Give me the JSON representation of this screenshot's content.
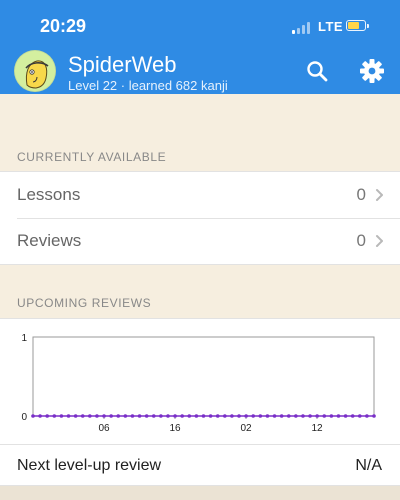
{
  "status_bar": {
    "time": "20:29",
    "network": "LTE",
    "signal_bars_on": 1,
    "battery_color": "#ffd54a"
  },
  "header": {
    "username": "SpiderWeb",
    "subtitle": "Level 22 · learned 682 kanji",
    "background": "#2f8be4",
    "icons": [
      "search-icon",
      "gear-icon"
    ]
  },
  "currently_available": {
    "title": "CURRENTLY AVAILABLE",
    "rows": [
      {
        "label": "Lessons",
        "value": "0"
      },
      {
        "label": "Reviews",
        "value": "0"
      }
    ]
  },
  "upcoming_reviews": {
    "title": "UPCOMING REVIEWS"
  },
  "chart_data": {
    "type": "line",
    "y_ticks": [
      "1",
      "0"
    ],
    "x_ticks": [
      "06",
      "16",
      "02",
      "12"
    ],
    "ylim": [
      0,
      1
    ],
    "values": [
      0,
      0,
      0,
      0,
      0,
      0,
      0,
      0,
      0,
      0,
      0,
      0,
      0,
      0,
      0,
      0,
      0,
      0,
      0,
      0,
      0,
      0,
      0,
      0,
      0,
      0,
      0,
      0,
      0,
      0,
      0,
      0,
      0,
      0,
      0,
      0,
      0,
      0,
      0,
      0,
      0,
      0,
      0,
      0,
      0,
      0,
      0,
      0,
      0
    ],
    "line_color": "#7a2fc8",
    "grid": false
  },
  "levelup": {
    "label": "Next level-up review",
    "value": "N/A"
  }
}
